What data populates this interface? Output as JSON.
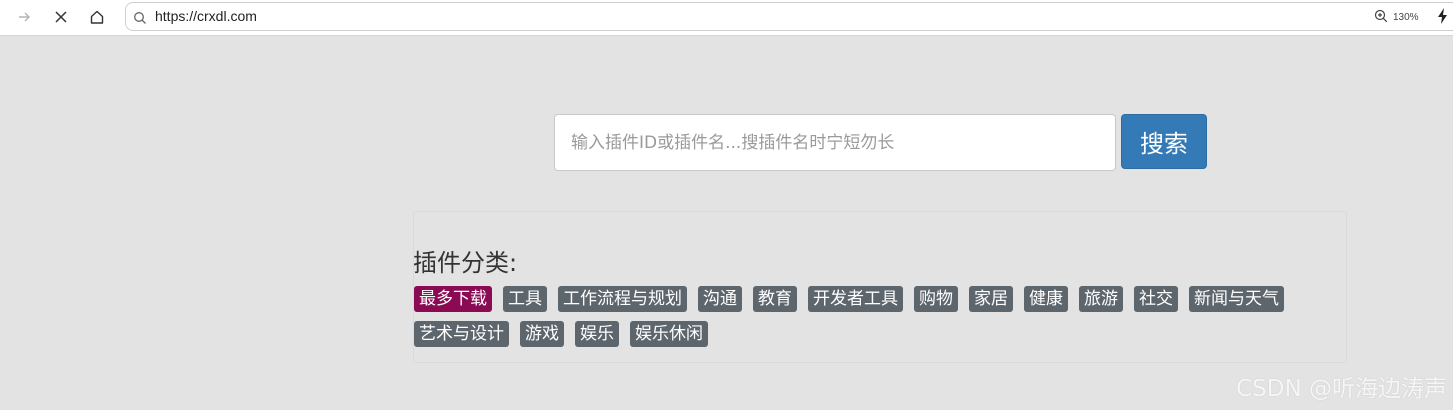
{
  "browser": {
    "url": "https://crxdl.com",
    "zoom": "130%",
    "icons": [
      "forward-icon",
      "close-icon",
      "home-icon",
      "search-icon",
      "zoom-icon",
      "bolt-icon"
    ]
  },
  "search": {
    "placeholder": "输入插件ID或插件名...搜插件名时宁短勿长",
    "button_label": "搜索"
  },
  "categories": {
    "title": "插件分类:",
    "tags": [
      {
        "label": "最多下载",
        "active": true
      },
      {
        "label": "工具",
        "active": false
      },
      {
        "label": "工作流程与规划",
        "active": false
      },
      {
        "label": "沟通",
        "active": false
      },
      {
        "label": "教育",
        "active": false
      },
      {
        "label": "开发者工具",
        "active": false
      },
      {
        "label": "购物",
        "active": false
      },
      {
        "label": "家居",
        "active": false
      },
      {
        "label": "健康",
        "active": false
      },
      {
        "label": "旅游",
        "active": false
      },
      {
        "label": "社交",
        "active": false
      },
      {
        "label": "新闻与天气",
        "active": false
      },
      {
        "label": "艺术与设计",
        "active": false
      },
      {
        "label": "游戏",
        "active": false
      },
      {
        "label": "娱乐",
        "active": false
      },
      {
        "label": "娱乐休闲",
        "active": false
      }
    ]
  },
  "watermark": "CSDN @听海边涛声",
  "colors": {
    "page_bg": "#e3e3e3",
    "button_primary": "#337ab7",
    "tag_default": "#5e666d",
    "tag_active": "#8a0b54"
  }
}
